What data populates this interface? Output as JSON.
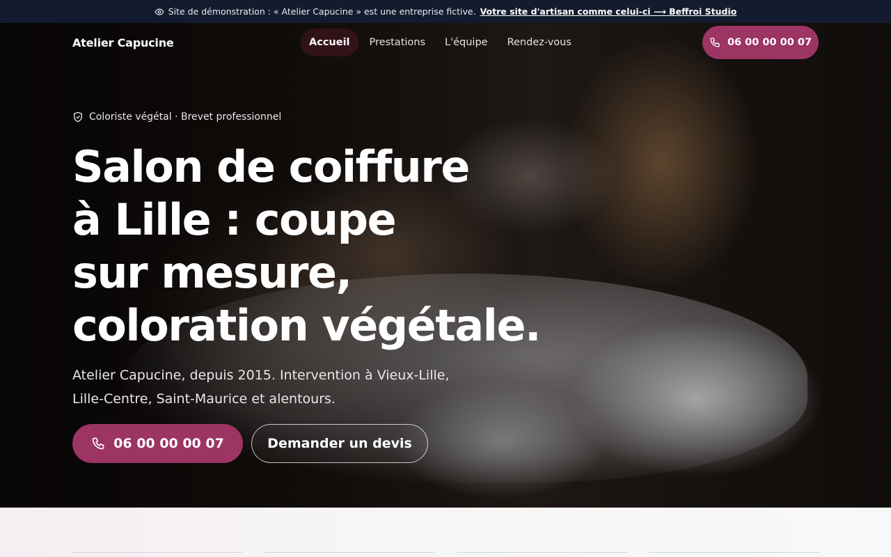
{
  "demo_banner": {
    "icon": "eye-icon",
    "message": "Site de démonstration : « Atelier Capucine » est une entreprise fictive.",
    "link_label": "Votre site d'artisan comme celui-ci ⟶ Beffroi Studio"
  },
  "header": {
    "brand": "Atelier Capucine",
    "menu": [
      {
        "label": "Accueil",
        "active": true
      },
      {
        "label": "Prestations",
        "active": false
      },
      {
        "label": "L'équipe",
        "active": false
      },
      {
        "label": "Rendez-vous",
        "active": false
      }
    ],
    "phone_label": "06 00 00 00 07",
    "phone_icon": "phone-icon"
  },
  "hero": {
    "badge_icon": "shield-check-icon",
    "badge": "Coloriste végétal · Brevet professionnel",
    "headline_lines": [
      "Salon de coiffure",
      "à Lille : coupe",
      "sur mesure,",
      "coloration végétale."
    ],
    "lead_line1": "Atelier Capucine, depuis 2015. Intervention à Vieux-Lille,",
    "lead_line2": "Lille-Centre, Saint-Maurice et alentours.",
    "cta_phone": "06 00 00 00 07",
    "cta_quote": "Demander un devis"
  },
  "colors": {
    "accent": "#9c3464",
    "banner_bg": "#131c2e",
    "below_bg": "#f7f5f6"
  }
}
